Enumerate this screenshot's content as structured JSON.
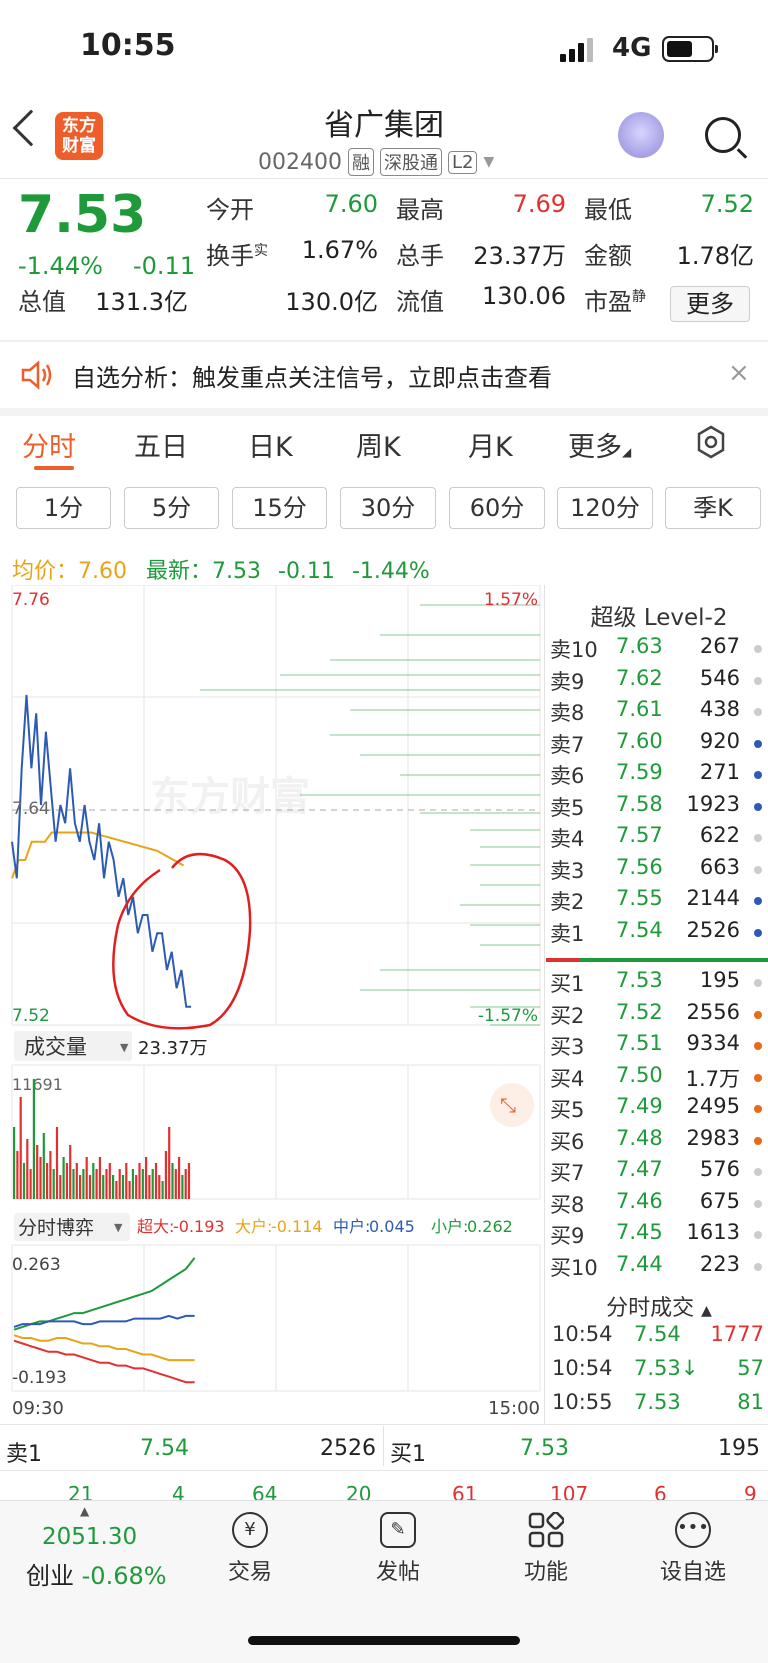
{
  "status_bar": {
    "time": "10:55",
    "network": "4G"
  },
  "header": {
    "logo_text": "东方财富",
    "title": "省广集团",
    "code": "002400",
    "tags": [
      "融",
      "深股通",
      "L2"
    ]
  },
  "quote": {
    "price": "7.53",
    "change_pct": "-1.44%",
    "change": "-0.11",
    "fields": [
      {
        "label": "今开",
        "value": "7.60",
        "color": "#1f9a3a"
      },
      {
        "label": "最高",
        "value": "7.69",
        "color": "#e03131"
      },
      {
        "label": "最低",
        "value": "7.52",
        "color": "#1f9a3a"
      },
      {
        "label": "换手",
        "sup": "实",
        "value": "1.67%",
        "color": "#222222"
      },
      {
        "label": "总手",
        "value": "23.37万",
        "color": "#222222"
      },
      {
        "label": "金额",
        "value": "1.78亿",
        "color": "#222222"
      },
      {
        "label": "总值",
        "value": "131.3亿",
        "color": "#222222"
      },
      {
        "label": "流值",
        "value": "130.0亿",
        "color": "#222222"
      },
      {
        "label": "市盈",
        "sup": "静",
        "value": "130.06",
        "color": "#222222"
      }
    ],
    "more_label": "更多"
  },
  "notice": {
    "text": "自选分析：触发重点关注信号，立即点击查看",
    "close": "×"
  },
  "tabs": [
    "分时",
    "五日",
    "日K",
    "周K",
    "月K",
    "更多"
  ],
  "segments": [
    "1分",
    "5分",
    "15分",
    "30分",
    "60分",
    "120分",
    "季K"
  ],
  "info_line": {
    "avg_label": "均价：",
    "avg": "7.60",
    "latest_label": "最新：",
    "latest": "7.53",
    "change": "-0.11",
    "pct": "-1.44%"
  },
  "chart": {
    "y_top": "7.76",
    "y_mid": "7.64",
    "y_bottom": "7.52",
    "pct_top": "1.57%",
    "pct_bottom": "-1.57%",
    "watermark": "东方财富",
    "volume_label": "成交量",
    "volume_total": "23.37万",
    "volume_max": "11691",
    "game_label": "分时博弈",
    "game_legend": [
      {
        "label": "超大:",
        "value": "-0.193",
        "color": "#e03131"
      },
      {
        "label": "大户:",
        "value": "-0.114",
        "color": "#e8a317"
      },
      {
        "label": "中户:",
        "value": "0.045",
        "color": "#2c5bb3"
      },
      {
        "label": "小户:",
        "value": "0.262",
        "color": "#1f9a3a"
      }
    ],
    "game_top": "0.263",
    "game_bottom": "-0.193",
    "time_start": "09:30",
    "time_end": "15:00"
  },
  "chart_data": {
    "type": "line",
    "title": "",
    "series": [
      {
        "name": "最新",
        "color": "#2c5bb3",
        "values": [
          7.62,
          7.6,
          7.66,
          7.7,
          7.66,
          7.69,
          7.64,
          7.68,
          7.65,
          7.62,
          7.64,
          7.63,
          7.66,
          7.63,
          7.62,
          7.64,
          7.62,
          7.61,
          7.63,
          7.6,
          7.62,
          7.61,
          7.59,
          7.6,
          7.58,
          7.59,
          7.57,
          7.58,
          7.58,
          7.56,
          7.57,
          7.57,
          7.55,
          7.56,
          7.54,
          7.55,
          7.53,
          7.53
        ]
      },
      {
        "name": "均价",
        "color": "#e8a317",
        "values": [
          7.6,
          7.61,
          7.61,
          7.62,
          7.62,
          7.62,
          7.625,
          7.625,
          7.625,
          7.625,
          7.625,
          7.625,
          7.625,
          7.624,
          7.623,
          7.622,
          7.621,
          7.62,
          7.619,
          7.618,
          7.617,
          7.616,
          7.615,
          7.613,
          7.611,
          7.609,
          7.607
        ]
      }
    ],
    "ylim": [
      7.52,
      7.76
    ],
    "xlabel": "",
    "ylabel": ""
  },
  "order_book": {
    "title": "超级 Level-2",
    "asks": [
      {
        "label": "卖10",
        "price": "7.63",
        "vol": "267",
        "dot": "#cccccc"
      },
      {
        "label": "卖9",
        "price": "7.62",
        "vol": "546",
        "dot": "#cccccc"
      },
      {
        "label": "卖8",
        "price": "7.61",
        "vol": "438",
        "dot": "#cccccc"
      },
      {
        "label": "卖7",
        "price": "7.60",
        "vol": "920",
        "dot": "#2c5bb3"
      },
      {
        "label": "卖6",
        "price": "7.59",
        "vol": "271",
        "dot": "#2c5bb3"
      },
      {
        "label": "卖5",
        "price": "7.58",
        "vol": "1923",
        "dot": "#2c5bb3"
      },
      {
        "label": "卖4",
        "price": "7.57",
        "vol": "622",
        "dot": "#cccccc"
      },
      {
        "label": "卖3",
        "price": "7.56",
        "vol": "663",
        "dot": "#cccccc"
      },
      {
        "label": "卖2",
        "price": "7.55",
        "vol": "2144",
        "dot": "#2c5bb3"
      },
      {
        "label": "卖1",
        "price": "7.54",
        "vol": "2526",
        "dot": "#2c5bb3"
      }
    ],
    "bids": [
      {
        "label": "买1",
        "price": "7.53",
        "vol": "195",
        "dot": "#cccccc"
      },
      {
        "label": "买2",
        "price": "7.52",
        "vol": "2556",
        "dot": "#e86a1a"
      },
      {
        "label": "买3",
        "price": "7.51",
        "vol": "9334",
        "dot": "#e86a1a"
      },
      {
        "label": "买4",
        "price": "7.50",
        "vol": "1.7万",
        "dot": "#e86a1a"
      },
      {
        "label": "买5",
        "price": "7.49",
        "vol": "2495",
        "dot": "#e86a1a"
      },
      {
        "label": "买6",
        "price": "7.48",
        "vol": "2983",
        "dot": "#e86a1a"
      },
      {
        "label": "买7",
        "price": "7.47",
        "vol": "576",
        "dot": "#cccccc"
      },
      {
        "label": "买8",
        "price": "7.46",
        "vol": "675",
        "dot": "#cccccc"
      },
      {
        "label": "买9",
        "price": "7.45",
        "vol": "1613",
        "dot": "#cccccc"
      },
      {
        "label": "买10",
        "price": "7.44",
        "vol": "223",
        "dot": "#cccccc"
      }
    ]
  },
  "trades": {
    "title": "分时成交",
    "rows": [
      {
        "time": "10:54",
        "price": "7.54",
        "vol": "1777"
      },
      {
        "time": "10:54",
        "price": "7.53↓",
        "vol": "57"
      },
      {
        "time": "10:55",
        "price": "7.53",
        "vol": "81"
      }
    ]
  },
  "bottom_book": {
    "sell_label": "卖1",
    "sell_price": "7.54",
    "sell_vol": "2526",
    "buy_label": "买1",
    "buy_price": "7.53",
    "buy_vol": "195",
    "sell_counts": [
      "21",
      "4",
      "64",
      "20"
    ],
    "buy_counts": [
      "61",
      "107",
      "6",
      "9"
    ]
  },
  "tabbar": {
    "index_value": "2051.30",
    "index_name": "创业",
    "index_pct": "-0.68%",
    "items": [
      "交易",
      "发帖",
      "功能",
      "设自选"
    ]
  }
}
